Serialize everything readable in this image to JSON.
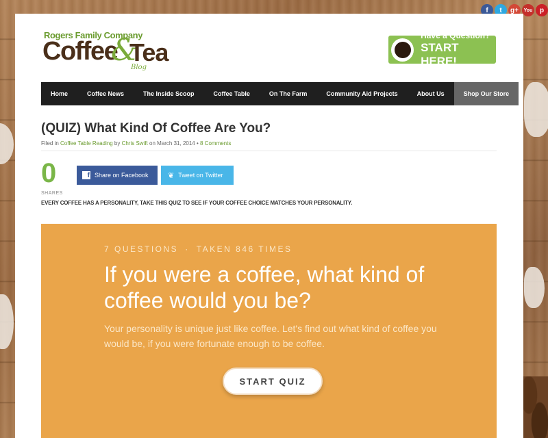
{
  "social": {
    "facebook_glyph": "f",
    "twitter_glyph": "t",
    "googleplus_glyph": "g+",
    "youtube_glyph": "You",
    "pinterest_glyph": "p"
  },
  "logo": {
    "brand": "Rogers Family Company",
    "word1": "Coffee",
    "amp": "&",
    "word2": "Tea",
    "sub": "Blog"
  },
  "cta": {
    "line1": "Have a Question?",
    "line2": "START HERE!"
  },
  "nav": {
    "items": [
      {
        "label": "Home"
      },
      {
        "label": "Coffee News"
      },
      {
        "label": "The Inside Scoop"
      },
      {
        "label": "Coffee Table"
      },
      {
        "label": "On The Farm"
      },
      {
        "label": "Community Aid Projects"
      },
      {
        "label": "About Us"
      },
      {
        "label": "Shop Our Store"
      }
    ]
  },
  "post": {
    "title": "(QUIZ) What Kind Of Coffee Are You?",
    "filed_prefix": "Filed in ",
    "category": "Coffee Table Reading",
    "by": " by ",
    "author": "Chris Swift",
    "on": " on March 31, 2014 • ",
    "comments": "8 Comments",
    "tagline": "EVERY COFFEE HAS A PERSONALITY, TAKE THIS QUIZ TO SEE IF YOUR COFFEE CHOICE MATCHES YOUR PERSONALITY."
  },
  "shares": {
    "count": "0",
    "label": "SHARES",
    "facebook_label": "Share on Facebook",
    "twitter_label": "Tweet on Twitter",
    "facebook_icon": "f",
    "twitter_icon": "❦"
  },
  "quiz": {
    "questions": "7 QUESTIONS",
    "dot": "·",
    "taken": "TAKEN 846 TIMES",
    "title": "If you were a coffee, what kind of coffee would you be?",
    "description": "Your personality is unique just like coffee. Let's find out what kind of coffee you would be, if you were fortunate enough to be coffee.",
    "start_label": "START QUIZ"
  },
  "colors": {
    "accent_green": "#7ab648",
    "nav_bg": "#1f1f1f",
    "quiz_bg": "#eaa54a",
    "facebook": "#3b5a9a",
    "twitter": "#49b6e8"
  }
}
